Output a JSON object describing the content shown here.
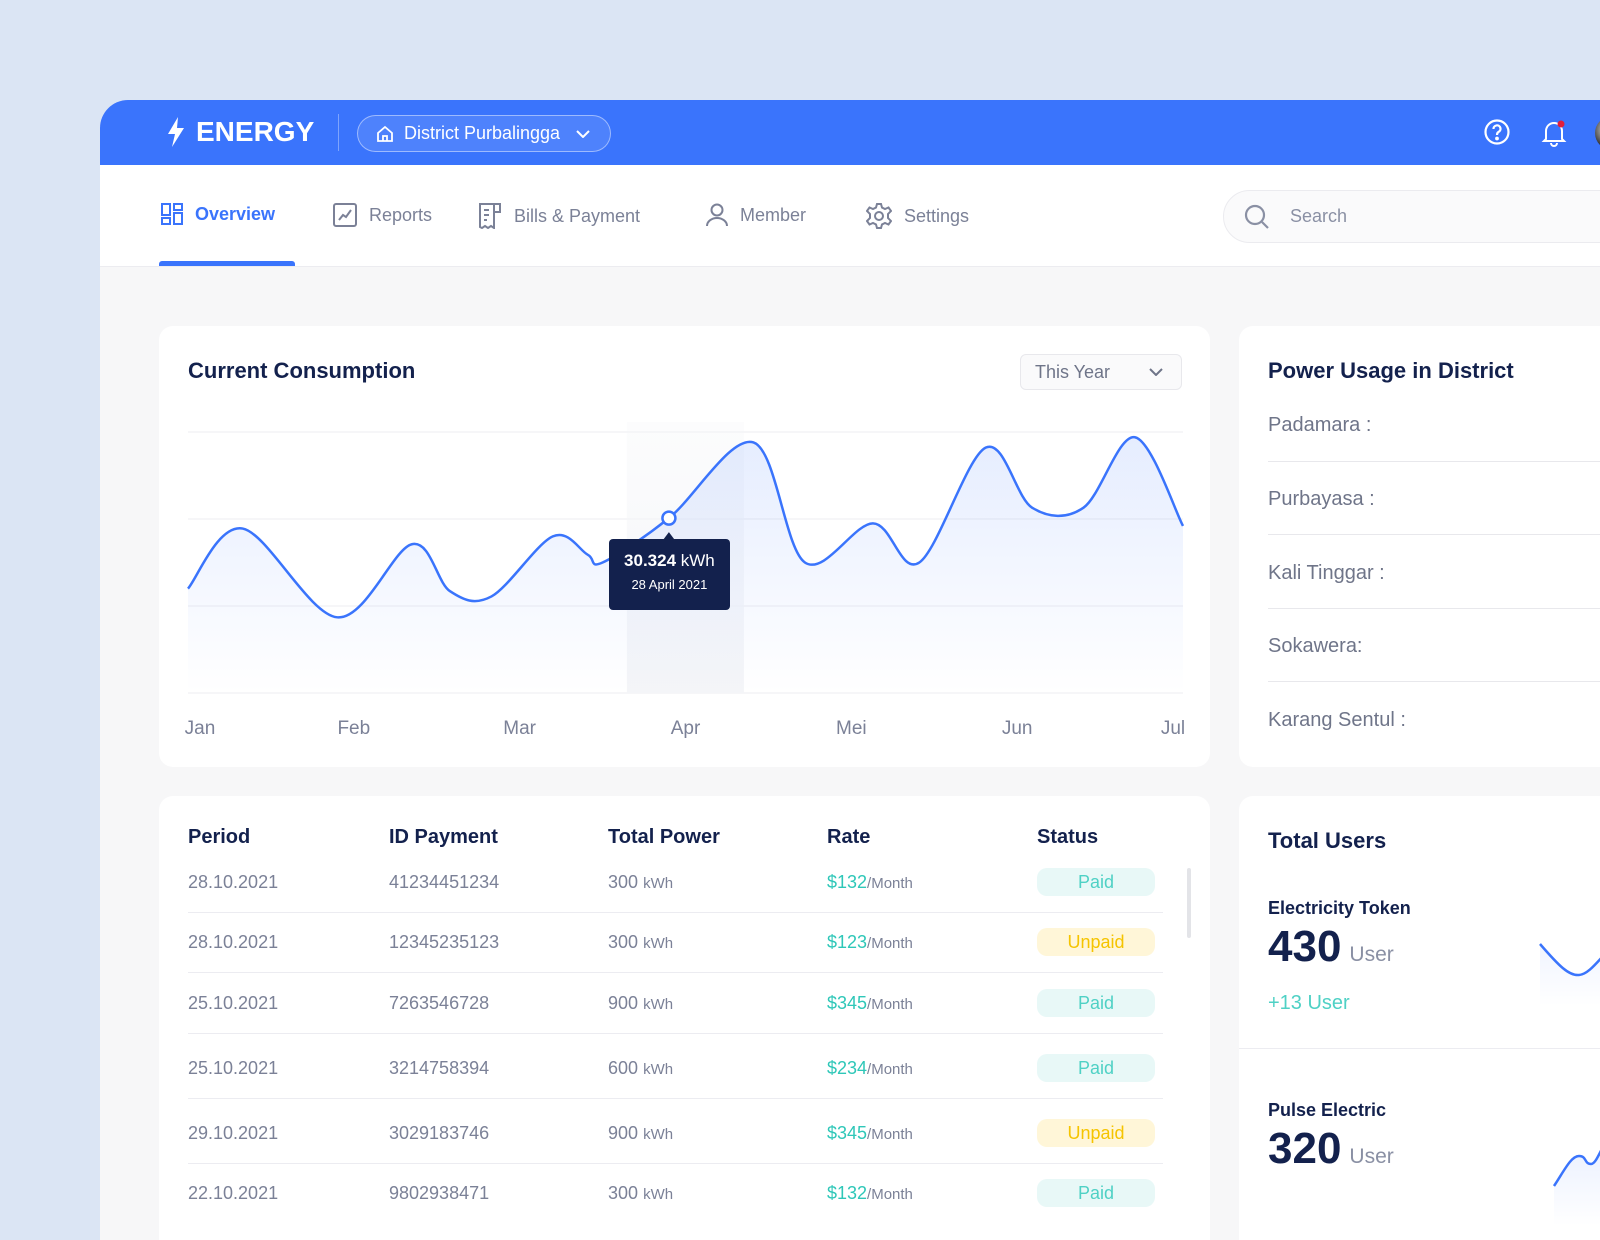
{
  "header": {
    "brand": "ENERGY",
    "district": "District Purbalingga"
  },
  "nav": {
    "tabs": [
      {
        "label": "Overview",
        "icon": "dashboard-icon"
      },
      {
        "label": "Reports",
        "icon": "chart-icon"
      },
      {
        "label": "Bills & Payment",
        "icon": "receipt-icon"
      },
      {
        "label": "Member",
        "icon": "user-icon"
      },
      {
        "label": "Settings",
        "icon": "gear-icon"
      }
    ],
    "search_placeholder": "Search"
  },
  "consumption": {
    "title": "Current Consumption",
    "period": "This Year",
    "tooltip": {
      "value": "30.324",
      "unit": "kWh",
      "date": "28 April 2021"
    }
  },
  "chart_data": {
    "type": "line",
    "title": "Current Consumption",
    "categories": [
      "Jan",
      "Feb",
      "Mar",
      "Apr",
      "Mei",
      "Jun",
      "Jul"
    ],
    "xlim": [
      0,
      6
    ],
    "ylim": [
      0,
      100
    ],
    "grid": true,
    "points": [
      [
        0,
        40
      ],
      [
        0.33,
        63
      ],
      [
        0.9,
        29
      ],
      [
        1.35,
        57
      ],
      [
        1.58,
        39
      ],
      [
        1.83,
        37
      ],
      [
        2.2,
        60
      ],
      [
        2.41,
        53
      ],
      [
        2.5,
        50
      ],
      [
        2.9,
        67
      ],
      [
        3.41,
        96
      ],
      [
        3.72,
        50
      ],
      [
        4.13,
        65
      ],
      [
        4.41,
        50
      ],
      [
        4.81,
        94
      ],
      [
        5.09,
        71
      ],
      [
        5.4,
        71
      ],
      [
        5.71,
        98
      ],
      [
        6,
        64
      ]
    ],
    "highlight": {
      "x": 2.9,
      "y": 67
    }
  },
  "district": {
    "title": "Power Usage in District",
    "items": [
      "Padamara :",
      "Purbayasa :",
      "Kali Tinggar :",
      "Sokawera:",
      "Karang Sentul :"
    ]
  },
  "table": {
    "headers": [
      "Period",
      "ID Payment",
      "Total Power",
      "Rate",
      "Status"
    ],
    "rows": [
      {
        "period": "28.10.2021",
        "id": "41234451234",
        "power": "300",
        "unit": "kWh",
        "rate": "$132",
        "per": "/Month",
        "status": "Paid"
      },
      {
        "period": "28.10.2021",
        "id": "12345235123",
        "power": "300",
        "unit": "kWh",
        "rate": "$123",
        "per": "/Month",
        "status": "Unpaid"
      },
      {
        "period": "25.10.2021",
        "id": "7263546728",
        "power": "900",
        "unit": "kWh",
        "rate": "$345",
        "per": "/Month",
        "status": "Paid"
      },
      {
        "period": "25.10.2021",
        "id": "3214758394",
        "power": "600",
        "unit": "kWh",
        "rate": "$234",
        "per": "/Month",
        "status": "Paid"
      },
      {
        "period": "29.10.2021",
        "id": "3029183746",
        "power": "900",
        "unit": "kWh",
        "rate": "$345",
        "per": "/Month",
        "status": "Unpaid"
      },
      {
        "period": "22.10.2021",
        "id": "9802938471",
        "power": "300",
        "unit": "kWh",
        "rate": "$132",
        "per": "/Month",
        "status": "Paid"
      }
    ]
  },
  "users": {
    "title": "Total Users",
    "items": [
      {
        "label": "Electricity Token",
        "value": "430",
        "unit": "User",
        "delta": "+13 User"
      },
      {
        "label": "Pulse Electric",
        "value": "320",
        "unit": "User"
      }
    ]
  },
  "colors": {
    "primary": "#3a74fc",
    "paid": "#4fd1c5",
    "unpaid": "#f5c400",
    "navy": "#13214d"
  }
}
